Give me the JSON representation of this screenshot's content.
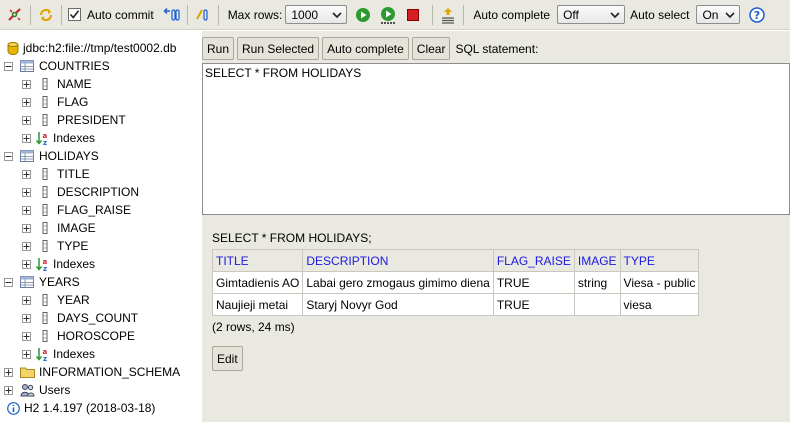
{
  "toolbar": {
    "auto_commit_label": "Auto commit",
    "auto_commit_checked": true,
    "max_rows_label": "Max rows:",
    "max_rows_value": "1000",
    "auto_complete_label": "Auto complete",
    "auto_complete_value": "Off",
    "auto_select_label": "Auto select",
    "auto_select_value": "On",
    "help_glyph": "?"
  },
  "tree": {
    "connection": "jdbc:h2:file://tmp/test0002.db",
    "tables": [
      {
        "name": "COUNTRIES",
        "columns": [
          "NAME",
          "FLAG",
          "PRESIDENT"
        ],
        "indexes_label": "Indexes"
      },
      {
        "name": "HOLIDAYS",
        "columns": [
          "TITLE",
          "DESCRIPTION",
          "FLAG_RAISE",
          "IMAGE",
          "TYPE"
        ],
        "indexes_label": "Indexes"
      },
      {
        "name": "YEARS",
        "columns": [
          "YEAR",
          "DAYS_COUNT",
          "HOROSCOPE"
        ],
        "indexes_label": "Indexes"
      }
    ],
    "schema": "INFORMATION_SCHEMA",
    "users": "Users",
    "version": "H2 1.4.197 (2018-03-18)"
  },
  "buttons": {
    "run": "Run",
    "run_selected": "Run Selected",
    "auto_complete": "Auto complete",
    "clear": "Clear",
    "sql_statement_label": "SQL statement:"
  },
  "editor": {
    "sql": "SELECT * FROM HOLIDAYS"
  },
  "result": {
    "statement": "SELECT * FROM HOLIDAYS;",
    "columns": [
      "TITLE",
      "DESCRIPTION",
      "FLAG_RAISE",
      "IMAGE",
      "TYPE"
    ],
    "rows": [
      [
        "Gimtadienis AO",
        "Labai gero zmogaus gimimo diena",
        "TRUE",
        "string",
        "Viesa - public"
      ],
      [
        "Naujieji metai",
        "Staryj Novyr God",
        "TRUE",
        "",
        "viesa"
      ]
    ],
    "summary": "(2 rows, 24 ms)",
    "edit_label": "Edit"
  }
}
